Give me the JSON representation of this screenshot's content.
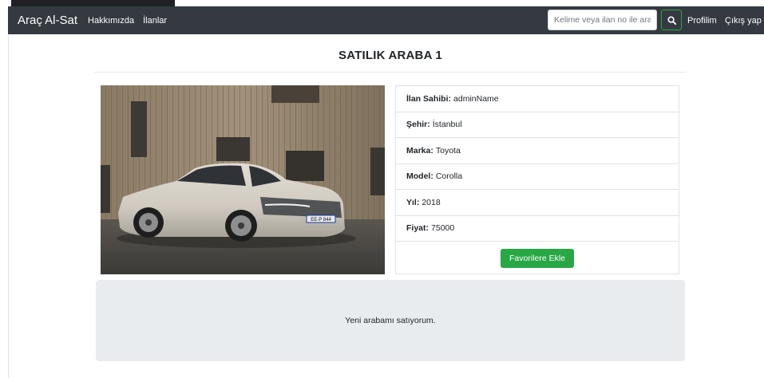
{
  "navbar": {
    "brand": "Araç Al-Sat",
    "links": [
      "Hakkımızda",
      "İlanlar"
    ],
    "search_placeholder": "Kelime veya ilan no ile ara",
    "profile_label": "Profilim",
    "logout_label": "Çıkış yap"
  },
  "listing": {
    "title": "SATILIK ARABA 1",
    "image_plate_text": "EE-P 844",
    "details": [
      {
        "label": "İlan Sahibi:",
        "value": "adminName"
      },
      {
        "label": "Şehir:",
        "value": "İstanbul"
      },
      {
        "label": "Marka:",
        "value": "Toyota"
      },
      {
        "label": "Model:",
        "value": "Corolla"
      },
      {
        "label": "Yıl:",
        "value": "2018"
      },
      {
        "label": "Fiyat:",
        "value": "75000"
      }
    ],
    "favorite_button": "Favorilere Ekle",
    "description": "Yeni arabamı satıyorum."
  },
  "colors": {
    "navbar_bg": "#343a40",
    "success": "#28a745",
    "description_bg": "#e9ecef",
    "border": "#dee2e6"
  },
  "icons": {
    "search": "search-icon"
  }
}
